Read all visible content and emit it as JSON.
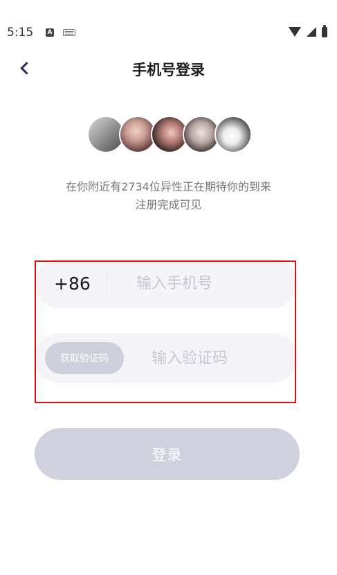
{
  "status_bar": {
    "time": "5:15",
    "notification_icon_a": "A",
    "icons": [
      "keyboard-icon",
      "wifi-icon",
      "signal-icon",
      "battery-icon"
    ]
  },
  "header": {
    "title": "手机号登录",
    "back_icon": "chevron-left-icon"
  },
  "avatars": [
    "avatar-1",
    "avatar-2",
    "avatar-3",
    "avatar-4",
    "avatar-5"
  ],
  "subtitle": {
    "line1": "在你附近有2734位异性正在期待你的到来",
    "line2": "注册完成可见"
  },
  "phone": {
    "country_code": "+86",
    "placeholder": "输入手机号",
    "value": ""
  },
  "code": {
    "get_code_label": "获取验证码",
    "placeholder": "输入验证码",
    "value": ""
  },
  "login": {
    "label": "登录"
  },
  "colors": {
    "accent": "#2c2b5a",
    "field_bg": "#f4f4f9",
    "button_disabled": "#cfd1de",
    "highlight": "#e01010"
  }
}
